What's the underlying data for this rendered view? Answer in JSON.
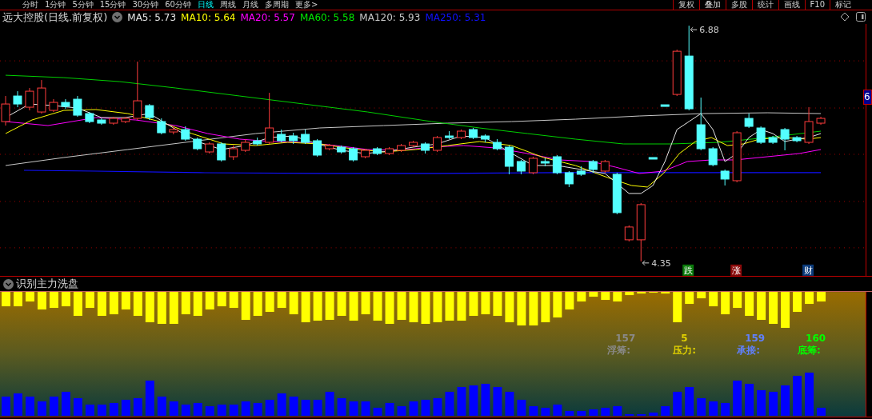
{
  "toolbar": {
    "tabs": [
      {
        "label": "分时",
        "selected": false
      },
      {
        "label": "1分钟",
        "selected": false
      },
      {
        "label": "5分钟",
        "selected": false
      },
      {
        "label": "15分钟",
        "selected": false
      },
      {
        "label": "30分钟",
        "selected": false
      },
      {
        "label": "60分钟",
        "selected": false
      },
      {
        "label": "日线",
        "selected": true
      },
      {
        "label": "周线",
        "selected": false
      },
      {
        "label": "月线",
        "selected": false
      },
      {
        "label": "多周期",
        "selected": false
      },
      {
        "label": "更多>",
        "selected": false
      }
    ],
    "buttons": [
      "复权",
      "叠加",
      "多股",
      "统计",
      "画线",
      "F10",
      "标记"
    ]
  },
  "legend": {
    "title": "远大控股(日线.前复权)",
    "averages": [
      {
        "label": "MA5: 5.73",
        "color": "#e6e6e6"
      },
      {
        "label": "MA10: 5.64",
        "color": "#ffff00"
      },
      {
        "label": "MA20: 5.57",
        "color": "#ff00ff"
      },
      {
        "label": "MA60: 5.58",
        "color": "#00e600"
      },
      {
        "label": "MA120: 5.93",
        "color": "#c8c8c8"
      },
      {
        "label": "MA250: 5.31",
        "color": "#1010ff"
      }
    ]
  },
  "price_chart": {
    "high_label": "6.88",
    "low_label": "4.35",
    "axis_label": "6",
    "signals": [
      {
        "text": "跌",
        "color": "#0a7a0a"
      },
      {
        "text": "涨",
        "color": "#8a0a0a"
      },
      {
        "text": "财",
        "color": "#0a3a7a"
      }
    ]
  },
  "indicator": {
    "title": "识别主力洗盘",
    "labels": [
      {
        "value": "157",
        "text": "浮筹:",
        "color": "#8a8a8a"
      },
      {
        "value": "5",
        "text": "压力:",
        "color": "#e0d000"
      },
      {
        "value": "159",
        "text": "承接:",
        "color": "#6080ff"
      },
      {
        "value": "160",
        "text": "底筹:",
        "color": "#00ff00"
      }
    ]
  }
}
